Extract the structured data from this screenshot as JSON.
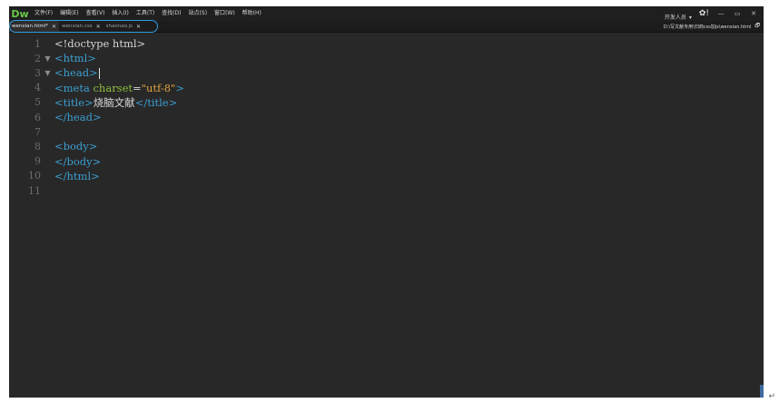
{
  "app": {
    "logo": "Dw",
    "menus": [
      "文件(F)",
      "编辑(E)",
      "查看(V)",
      "插入(I)",
      "工具(T)",
      "查找(D)",
      "站点(S)",
      "窗口(W)",
      "帮助(H)"
    ],
    "workspace": "开发人员",
    "workspace_caret": "▾",
    "gear": "✿!",
    "window_buttons": [
      "—",
      "▭",
      "✕"
    ]
  },
  "tabs": [
    {
      "label": "wenxian.html*",
      "active": true
    },
    {
      "label": "wenxian.css",
      "active": false
    },
    {
      "label": "shaonao.js",
      "active": false
    }
  ],
  "tab_close": "✕",
  "file_path": "D:\\写文献专用\\归商css加js\\wenxian.html",
  "path_icon": "🗗",
  "editor": {
    "lines": [
      {
        "no": "1",
        "fold": "",
        "tokens": [
          {
            "t": "plain",
            "v": "<!doctype html>"
          }
        ]
      },
      {
        "no": "2",
        "fold": "▼",
        "tokens": [
          {
            "t": "tag",
            "v": "<html>"
          }
        ]
      },
      {
        "no": "3",
        "fold": "▼",
        "tokens": [
          {
            "t": "tag",
            "v": "<head>"
          }
        ],
        "caret": true
      },
      {
        "no": "4",
        "fold": "",
        "tokens": [
          {
            "t": "tag",
            "v": "<meta "
          },
          {
            "t": "attr",
            "v": "charset"
          },
          {
            "t": "eq",
            "v": "="
          },
          {
            "t": "str",
            "v": "\"utf-8\""
          },
          {
            "t": "tag",
            "v": ">"
          }
        ]
      },
      {
        "no": "5",
        "fold": "",
        "tokens": [
          {
            "t": "tag",
            "v": "<title>"
          },
          {
            "t": "plain",
            "v": "烧脑文献"
          },
          {
            "t": "tag",
            "v": "</title>"
          }
        ]
      },
      {
        "no": "6",
        "fold": "",
        "tokens": [
          {
            "t": "tag",
            "v": "</head>"
          }
        ]
      },
      {
        "no": "7",
        "fold": "",
        "tokens": []
      },
      {
        "no": "8",
        "fold": "",
        "tokens": [
          {
            "t": "tag",
            "v": "<body>"
          }
        ]
      },
      {
        "no": "9",
        "fold": "",
        "tokens": [
          {
            "t": "tag",
            "v": "</body>"
          }
        ]
      },
      {
        "no": "10",
        "fold": "",
        "tokens": [
          {
            "t": "tag",
            "v": "</html>"
          }
        ]
      },
      {
        "no": "11",
        "fold": "",
        "tokens": []
      }
    ]
  },
  "enter_mark": "↵",
  "colors": {
    "background": "#262626",
    "tag": "#3b9fd1",
    "attr": "#8fbf3f",
    "string": "#e0a23b",
    "highlight": "#2e9be0"
  }
}
